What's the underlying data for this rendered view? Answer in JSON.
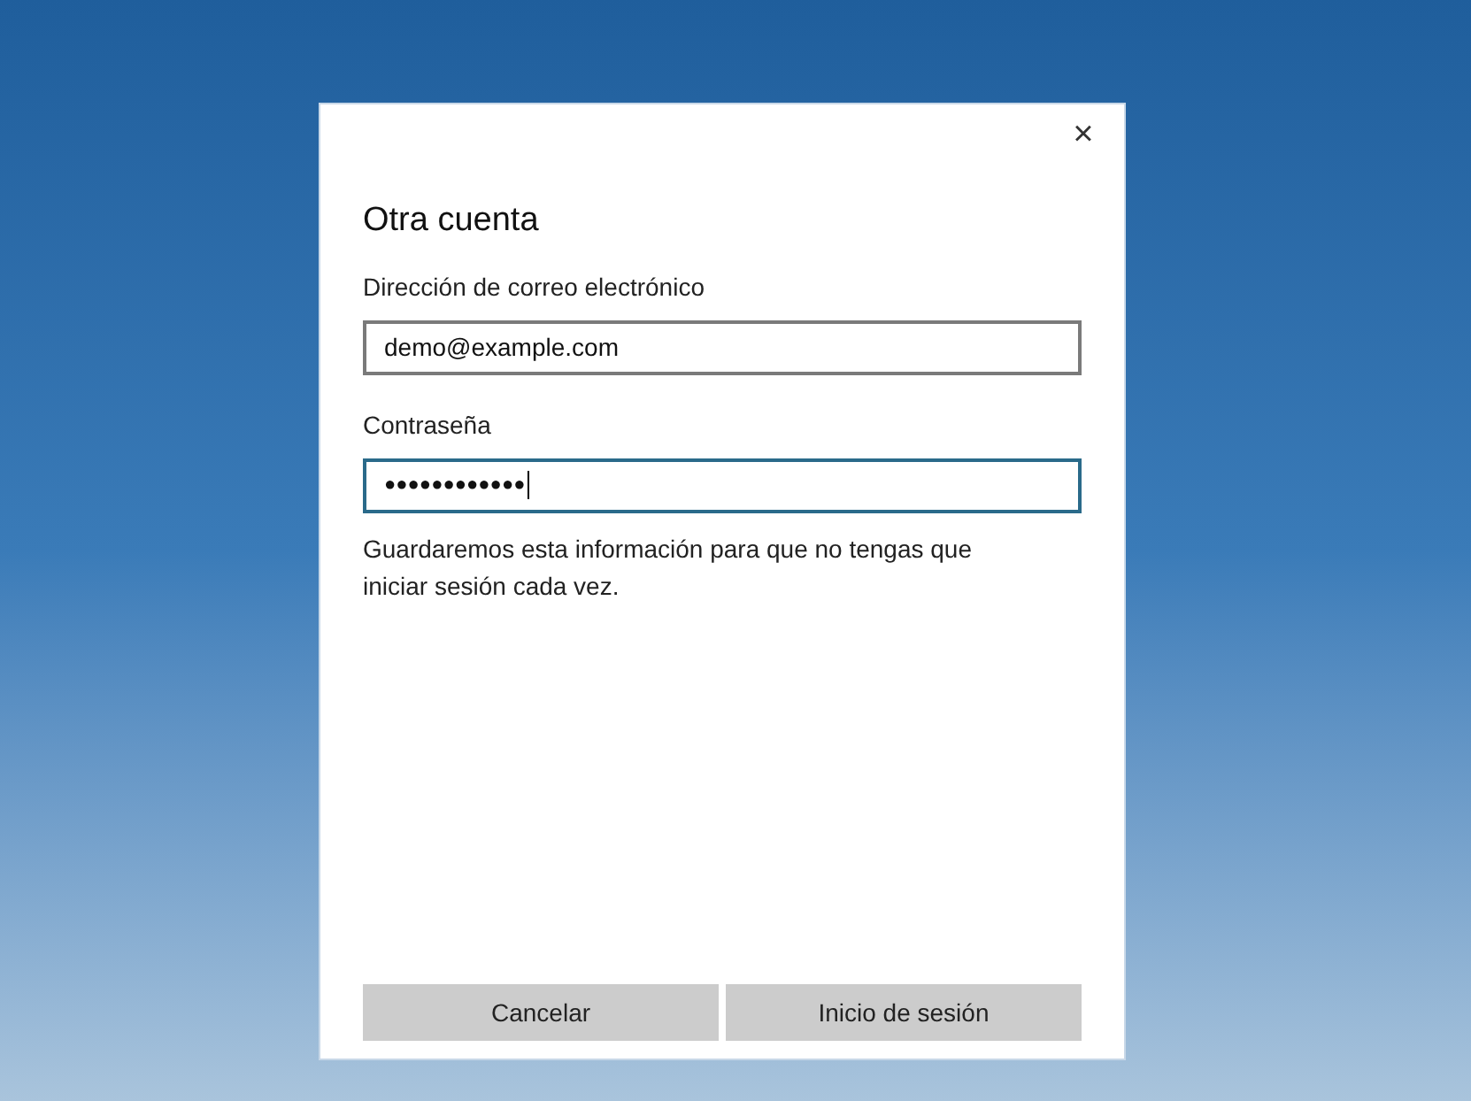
{
  "dialog": {
    "close": "×",
    "title": "Otra cuenta",
    "fields": [
      {
        "label": "Dirección de correo electrónico",
        "value": "demo@example.com",
        "focused": false
      },
      {
        "label": "Contraseña",
        "value": "●●●●●●●●●●●●",
        "focused": true
      }
    ],
    "note": "Guardaremos esta información para que no tengas que iniciar sesión cada vez.",
    "buttons": [
      "Cancelar",
      "Inicio de sesión"
    ]
  }
}
